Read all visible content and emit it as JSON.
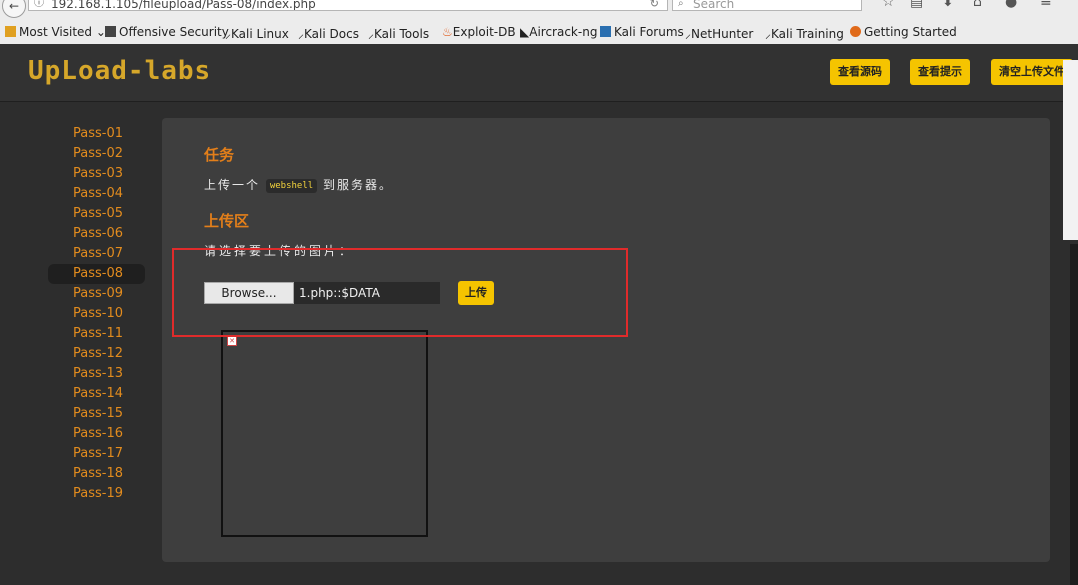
{
  "browser": {
    "url": "192.168.1.105/fileupload/Pass-08/index.php",
    "search_placeholder": "Search",
    "bookmarks": [
      {
        "label": "Most Visited",
        "icon": "folder-icon"
      },
      {
        "label": "Offensive Security",
        "icon": "offsec-icon"
      },
      {
        "label": "Kali Linux",
        "icon": "kali-dragon-icon"
      },
      {
        "label": "Kali Docs",
        "icon": "kali-dragon-icon"
      },
      {
        "label": "Kali Tools",
        "icon": "kali-dragon-icon"
      },
      {
        "label": "Exploit-DB",
        "icon": "exploitdb-icon"
      },
      {
        "label": "Aircrack-ng",
        "icon": "aircrack-icon"
      },
      {
        "label": "Kali Forums",
        "icon": "kali-forums-icon"
      },
      {
        "label": "NetHunter",
        "icon": "kali-dragon-icon"
      },
      {
        "label": "Kali Training",
        "icon": "kali-dragon-icon"
      },
      {
        "label": "Getting Started",
        "icon": "firefox-icon"
      }
    ]
  },
  "header": {
    "logo": "UpLoad-labs",
    "buttons": [
      "查看源码",
      "查看提示",
      "清空上传文件"
    ]
  },
  "sidebar": {
    "items": [
      "Pass-01",
      "Pass-02",
      "Pass-03",
      "Pass-04",
      "Pass-05",
      "Pass-06",
      "Pass-07",
      "Pass-08",
      "Pass-09",
      "Pass-10",
      "Pass-11",
      "Pass-12",
      "Pass-13",
      "Pass-14",
      "Pass-15",
      "Pass-16",
      "Pass-17",
      "Pass-18",
      "Pass-19"
    ],
    "active": "Pass-08"
  },
  "main": {
    "task_title": "任务",
    "task_prefix": "上传一个",
    "task_code": "webshell",
    "task_suffix": "到服务器。",
    "upload_title": "上传区",
    "choose_label": "请选择要上传的图片：",
    "browse_label": "Browse...",
    "file_value": "1.php::$DATA",
    "upload_button": "上传"
  },
  "colors": {
    "accent_orange": "#e37f1a",
    "button_yellow": "#f5c400",
    "highlight_red": "#e02b2b"
  }
}
